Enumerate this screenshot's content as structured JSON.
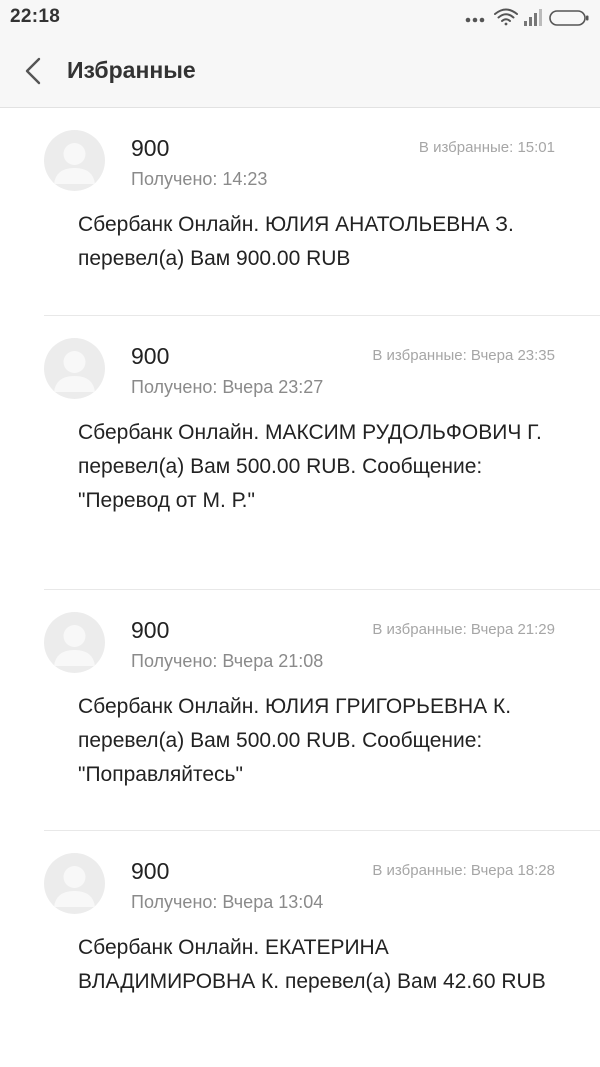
{
  "status_bar": {
    "time": "22:18",
    "icons": [
      "more-dots-icon",
      "wifi-icon",
      "signal-icon",
      "battery-icon"
    ]
  },
  "header": {
    "title": "Избранные",
    "back_icon": "chevron-left-icon"
  },
  "messages": [
    {
      "sender": "900",
      "received": "Получено: 14:23",
      "favorited": "В избранные: 15:01",
      "body": "Сбербанк Онлайн. ЮЛИЯ АНАТОЛЬЕВНА З. перевел(а) Вам 900.00 RUB"
    },
    {
      "sender": "900",
      "received": "Получено: Вчера 23:27",
      "favorited": "В избранные: Вчера 23:35",
      "body": "Сбербанк Онлайн. МАКСИМ РУДОЛЬФОВИЧ Г. перевел(а) Вам 500.00 RUB. Сообщение: \"Перевод от М. Р.\""
    },
    {
      "sender": "900",
      "received": "Получено: Вчера 21:08",
      "favorited": "В избранные: Вчера 21:29",
      "body": "Сбербанк Онлайн. ЮЛИЯ ГРИГОРЬЕВНА К. перевел(а) Вам 500.00 RUB. Сообщение: \"Поправляйтесь\""
    },
    {
      "sender": "900",
      "received": "Получено: Вчера 13:04",
      "favorited": "В избранные: Вчера 18:28",
      "body": "Сбербанк Онлайн. ЕКАТЕРИНА ВЛАДИМИРОВНА К. перевел(а) Вам 42.60 RUB"
    }
  ]
}
